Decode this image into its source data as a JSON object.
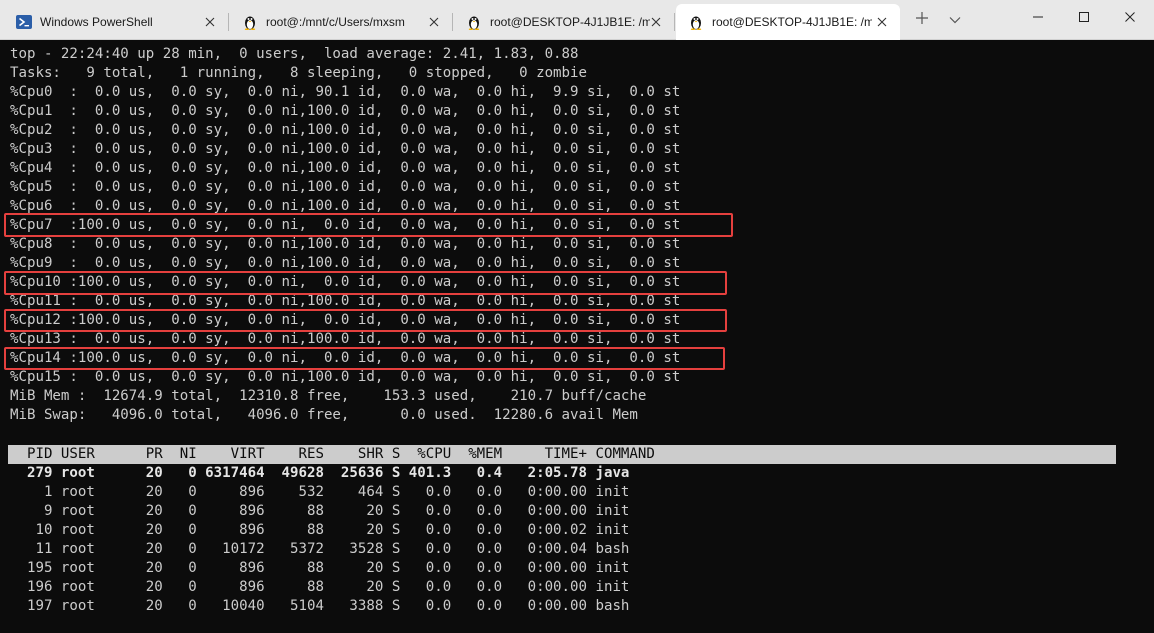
{
  "tabs": [
    {
      "label": "Windows PowerShell",
      "icon": "powershell-icon",
      "active": false
    },
    {
      "label": "root@:/mnt/c/Users/mxsm",
      "icon": "linux-penguin-icon",
      "active": false
    },
    {
      "label": "root@DESKTOP-4J1JB1E: /m",
      "icon": "linux-penguin-icon",
      "active": false
    },
    {
      "label": "root@DESKTOP-4J1JB1E: /m",
      "icon": "linux-penguin-icon",
      "active": true
    }
  ],
  "toolbar": {
    "new_tab_icon": "plus-icon",
    "dropdown_icon": "chevron-down-icon"
  },
  "window_controls": [
    "minimize-icon",
    "maximize-icon",
    "close-icon"
  ],
  "colors": {
    "terminal_bg": "#0c0c0c",
    "terminal_fg": "#cccccc",
    "highlight": "#e5403e",
    "header_bar": "#cccccc"
  },
  "terminal": {
    "summary": [
      "top - 22:24:40 up 28 min,  0 users,  load average: 2.41, 1.83, 0.88",
      "Tasks:   9 total,   1 running,   8 sleeping,   0 stopped,   0 zombie"
    ],
    "cpus": [
      "%Cpu0  :  0.0 us,  0.0 sy,  0.0 ni, 90.1 id,  0.0 wa,  0.0 hi,  9.9 si,  0.0 st",
      "%Cpu1  :  0.0 us,  0.0 sy,  0.0 ni,100.0 id,  0.0 wa,  0.0 hi,  0.0 si,  0.0 st",
      "%Cpu2  :  0.0 us,  0.0 sy,  0.0 ni,100.0 id,  0.0 wa,  0.0 hi,  0.0 si,  0.0 st",
      "%Cpu3  :  0.0 us,  0.0 sy,  0.0 ni,100.0 id,  0.0 wa,  0.0 hi,  0.0 si,  0.0 st",
      "%Cpu4  :  0.0 us,  0.0 sy,  0.0 ni,100.0 id,  0.0 wa,  0.0 hi,  0.0 si,  0.0 st",
      "%Cpu5  :  0.0 us,  0.0 sy,  0.0 ni,100.0 id,  0.0 wa,  0.0 hi,  0.0 si,  0.0 st",
      "%Cpu6  :  0.0 us,  0.0 sy,  0.0 ni,100.0 id,  0.0 wa,  0.0 hi,  0.0 si,  0.0 st",
      "%Cpu7  :100.0 us,  0.0 sy,  0.0 ni,  0.0 id,  0.0 wa,  0.0 hi,  0.0 si,  0.0 st",
      "%Cpu8  :  0.0 us,  0.0 sy,  0.0 ni,100.0 id,  0.0 wa,  0.0 hi,  0.0 si,  0.0 st",
      "%Cpu9  :  0.0 us,  0.0 sy,  0.0 ni,100.0 id,  0.0 wa,  0.0 hi,  0.0 si,  0.0 st",
      "%Cpu10 :100.0 us,  0.0 sy,  0.0 ni,  0.0 id,  0.0 wa,  0.0 hi,  0.0 si,  0.0 st",
      "%Cpu11 :  0.0 us,  0.0 sy,  0.0 ni,100.0 id,  0.0 wa,  0.0 hi,  0.0 si,  0.0 st",
      "%Cpu12 :100.0 us,  0.0 sy,  0.0 ni,  0.0 id,  0.0 wa,  0.0 hi,  0.0 si,  0.0 st",
      "%Cpu13 :  0.0 us,  0.0 sy,  0.0 ni,100.0 id,  0.0 wa,  0.0 hi,  0.0 si,  0.0 st",
      "%Cpu14 :100.0 us,  0.0 sy,  0.0 ni,  0.0 id,  0.0 wa,  0.0 hi,  0.0 si,  0.0 st",
      "%Cpu15 :  0.0 us,  0.0 sy,  0.0 ni,100.0 id,  0.0 wa,  0.0 hi,  0.0 si,  0.0 st"
    ],
    "mem": [
      "MiB Mem :  12674.9 total,  12310.8 free,    153.3 used,    210.7 buff/cache",
      "MiB Swap:   4096.0 total,   4096.0 free,      0.0 used.  12280.6 avail Mem"
    ],
    "proc_header": "  PID USER      PR  NI    VIRT    RES    SHR S  %CPU  %MEM     TIME+ COMMAND",
    "processes": [
      "  279 root      20   0 6317464  49628  25636 S 401.3   0.4   2:05.78 java",
      "    1 root      20   0     896    532    464 S   0.0   0.0   0:00.00 init",
      "    9 root      20   0     896     88     20 S   0.0   0.0   0:00.00 init",
      "   10 root      20   0     896     88     20 S   0.0   0.0   0:00.02 init",
      "   11 root      20   0   10172   5372   3528 S   0.0   0.0   0:00.04 bash",
      "  195 root      20   0     896     88     20 S   0.0   0.0   0:00.00 init",
      "  196 root      20   0     896     88     20 S   0.0   0.0   0:00.00 init",
      "  197 root      20   0   10040   5104   3388 S   0.0   0.0   0:00.00 bash"
    ]
  }
}
